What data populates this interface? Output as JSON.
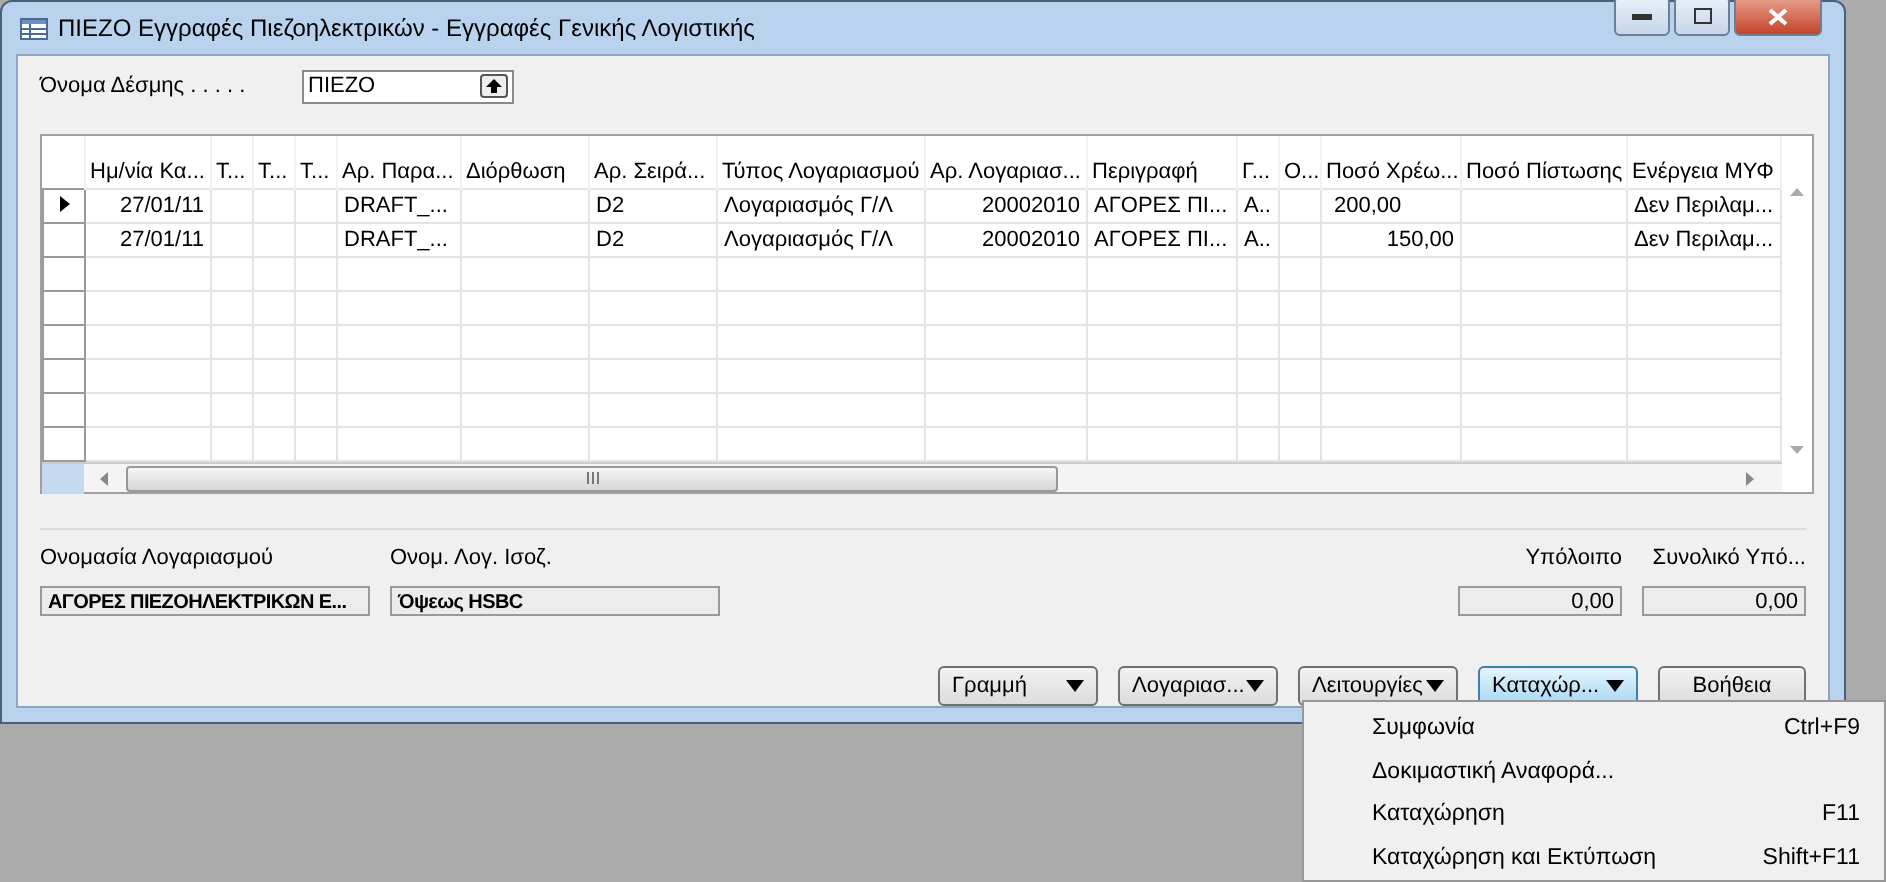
{
  "window": {
    "title": "ΠΙΕΖΟ Εγγραφές Πιεζοηλεκτρικών - Εγγραφές Γενικής Λογιστικής"
  },
  "batch": {
    "label": "Όνομα Δέσμης . . . . .",
    "value": "ΠΙΕΖΟ"
  },
  "table": {
    "columns": [
      {
        "label": "Ημ/νία Κα...",
        "kind": "number"
      },
      {
        "label": "Τ...",
        "kind": "text"
      },
      {
        "label": "Τ...",
        "kind": "text"
      },
      {
        "label": "Τ...",
        "kind": "text"
      },
      {
        "label": "Αρ. Παρα...",
        "kind": "text"
      },
      {
        "label": "Διόρθωση",
        "kind": "text"
      },
      {
        "label": "Αρ. Σειρά...",
        "kind": "text"
      },
      {
        "label": "Τύπος Λογαριασμού",
        "kind": "text"
      },
      {
        "label": "Αρ. Λογαριασ...",
        "kind": "number"
      },
      {
        "label": "Περιγραφή",
        "kind": "text"
      },
      {
        "label": "Γ...",
        "kind": "text"
      },
      {
        "label": "Ο...",
        "kind": "text"
      },
      {
        "label": "Ποσό Χρέω...",
        "kind": "number"
      },
      {
        "label": "Ποσό Πίστωσης",
        "kind": "number"
      },
      {
        "label": "Ενέργεια ΜΥΦ",
        "kind": "text"
      }
    ],
    "rows": [
      {
        "selected": true,
        "cells": [
          "27/01/11",
          "",
          "",
          "",
          "DRAFT_...",
          "",
          "D2",
          "Λογαριασμός Γ/Λ",
          "20002010",
          "ΑΓΟΡΕΣ ΠΙ...",
          "Α..",
          "",
          "200,00",
          "",
          "Δεν Περιλαμ..."
        ]
      },
      {
        "selected": false,
        "cells": [
          "27/01/11",
          "",
          "",
          "",
          "DRAFT_...",
          "",
          "D2",
          "Λογαριασμός Γ/Λ",
          "20002010",
          "ΑΓΟΡΕΣ ΠΙ...",
          "Α..",
          "",
          "150,00",
          "",
          "Δεν Περιλαμ..."
        ]
      }
    ]
  },
  "info": [
    {
      "label": "Ονομασία Λογαριασμού",
      "value": "ΑΓΟΡΕΣ ΠΙΕΖΟΗΛΕΚΤΡΙΚΩΝ Ε...",
      "kind": "text"
    },
    {
      "label": "Ονομ. Λογ. Ισοζ.",
      "value": "Όψεως HSBC",
      "kind": "text"
    },
    {
      "label": "Υπόλοιπο",
      "value": "0,00",
      "kind": "amount"
    },
    {
      "label": "Συνολικό Υπό...",
      "value": "0,00",
      "kind": "amount"
    }
  ],
  "buttons": [
    {
      "label": "Γραμμή",
      "kind": "menu",
      "selected": false
    },
    {
      "label": "Λογαριασ...",
      "kind": "menu",
      "selected": false
    },
    {
      "label": "Λειτουργίες",
      "kind": "menu",
      "selected": false
    },
    {
      "label": "Καταχώρ...",
      "kind": "menu",
      "selected": true
    },
    {
      "label": "Βοήθεια",
      "kind": "plain",
      "selected": false
    }
  ],
  "menu": [
    {
      "label": "Συμφωνία",
      "shortcut": "Ctrl+F9"
    },
    {
      "label": "Δοκιμαστική Αναφορά..."
    },
    {
      "label": "Καταχώρηση",
      "shortcut": "F11"
    },
    {
      "label": "Καταχώρηση και Εκτύπωση",
      "shortcut": "Shift+F11"
    }
  ]
}
